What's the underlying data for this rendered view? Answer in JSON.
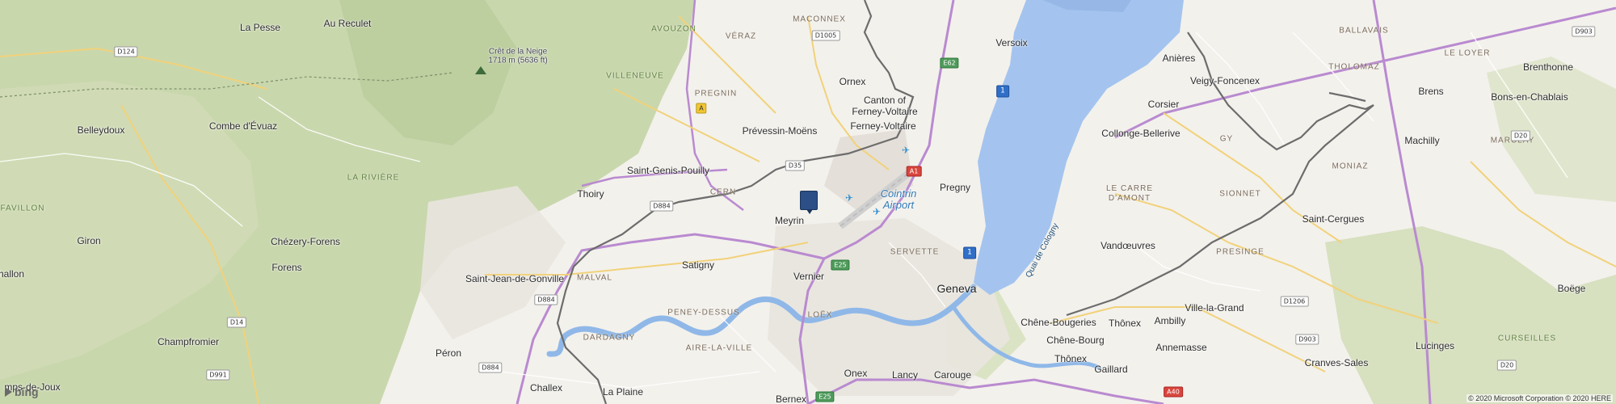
{
  "map": {
    "places": [
      {
        "name": "La Pesse",
        "kind": "town"
      },
      {
        "name": "Au Reculet",
        "kind": "town"
      },
      {
        "name": "Belleydoux",
        "kind": "town"
      },
      {
        "name": "Combe d'Évuaz",
        "kind": "town"
      },
      {
        "name": "Giron",
        "kind": "town"
      },
      {
        "name": "Chézery-Forens",
        "kind": "town"
      },
      {
        "name": "Forens",
        "kind": "town"
      },
      {
        "name": "hallon",
        "kind": "town"
      },
      {
        "name": "Champfromier",
        "kind": "town"
      },
      {
        "name": "mps-de-Joux",
        "kind": "town"
      },
      {
        "name": "Thoiry",
        "kind": "town"
      },
      {
        "name": "Saint-Genis-Pouilly",
        "kind": "town"
      },
      {
        "name": "Saint-Jean-de-Gonville",
        "kind": "town"
      },
      {
        "name": "Péron",
        "kind": "town"
      },
      {
        "name": "Challex",
        "kind": "town"
      },
      {
        "name": "La Plaine",
        "kind": "town"
      },
      {
        "name": "Prévessin-Moëns",
        "kind": "town"
      },
      {
        "name": "Ornex",
        "kind": "town"
      },
      {
        "name": "Canton of\nFerney-Voltaire",
        "kind": "town"
      },
      {
        "name": "Ferney-Voltaire",
        "kind": "town"
      },
      {
        "name": "Versoix",
        "kind": "town"
      },
      {
        "name": "Meyrin",
        "kind": "town"
      },
      {
        "name": "Satigny",
        "kind": "town"
      },
      {
        "name": "Vernier",
        "kind": "town"
      },
      {
        "name": "Onex",
        "kind": "town"
      },
      {
        "name": "Bernex",
        "kind": "town"
      },
      {
        "name": "Lancy",
        "kind": "town"
      },
      {
        "name": "Carouge",
        "kind": "town"
      },
      {
        "name": "Geneva",
        "kind": "city"
      },
      {
        "name": "Pregny",
        "kind": "town"
      },
      {
        "name": "Anières",
        "kind": "town"
      },
      {
        "name": "Corsier",
        "kind": "town"
      },
      {
        "name": "Collonge-Bellerive",
        "kind": "town"
      },
      {
        "name": "Vandœuvres",
        "kind": "town"
      },
      {
        "name": "Chêne-Bougeries",
        "kind": "town"
      },
      {
        "name": "Chêne-Bourg",
        "kind": "town"
      },
      {
        "name": "Thônex",
        "kind": "town"
      },
      {
        "name": "Thônex",
        "kind": "town"
      },
      {
        "name": "Gaillard",
        "kind": "town"
      },
      {
        "name": "Ambilly",
        "kind": "town"
      },
      {
        "name": "Annemasse",
        "kind": "town"
      },
      {
        "name": "Ville-la-Grand",
        "kind": "town"
      },
      {
        "name": "Veigy-Foncenex",
        "kind": "town"
      },
      {
        "name": "Brenthonne",
        "kind": "town"
      },
      {
        "name": "Brens",
        "kind": "town"
      },
      {
        "name": "Bons-en-Chablais",
        "kind": "town"
      },
      {
        "name": "Machilly",
        "kind": "town"
      },
      {
        "name": "Saint-Cergues",
        "kind": "town"
      },
      {
        "name": "Boëge",
        "kind": "town"
      },
      {
        "name": "Lucinges",
        "kind": "town"
      },
      {
        "name": "Cranves-Sales",
        "kind": "town"
      }
    ],
    "districts": [
      "MACONNEX",
      "VÉRAZ",
      "AVOUZON",
      "VILLENEUVE",
      "PREGNIN",
      "CERN",
      "LA RIVIÈRE",
      "FAVILLON",
      "MALVAL",
      "PENEY-DESSUS",
      "DARDAGNY",
      "AIRE-LA-VILLE",
      "LOËX",
      "SERVETTE",
      "LE CARRE\nD'AMONT",
      "SIONNET",
      "PRESINGE",
      "GY",
      "BALLAVAIS",
      "THOLOMAZ",
      "LE LOYER",
      "MARCLAY",
      "MONIAZ",
      "CURSEILLES"
    ],
    "peak": {
      "name": "Crêt de la Neige",
      "elevation": "1718 m (5636 ft)"
    },
    "airport": {
      "name": "Cointrin\nAirport"
    },
    "water_label": "Quai de Cologny",
    "roads": [
      "D124",
      "D1005",
      "E62",
      "A",
      "D35",
      "A1",
      "D884",
      "D884",
      "D884",
      "E25",
      "E25",
      "D14",
      "D991",
      "D1206",
      "D903",
      "D20",
      "D20",
      "D903",
      "A40",
      "1",
      "1"
    ],
    "pin_label": "selected-location",
    "logo": "bing",
    "copyright": "© 2020 Microsoft Corporation © 2020 HERE"
  },
  "colors": {
    "land": "#f3f1ec",
    "forest": "#c9d7ad",
    "lake": "#a4c4ef",
    "river": "#8fb8e8",
    "motorway": "#b98ad0",
    "pin": "#2b4f86"
  }
}
